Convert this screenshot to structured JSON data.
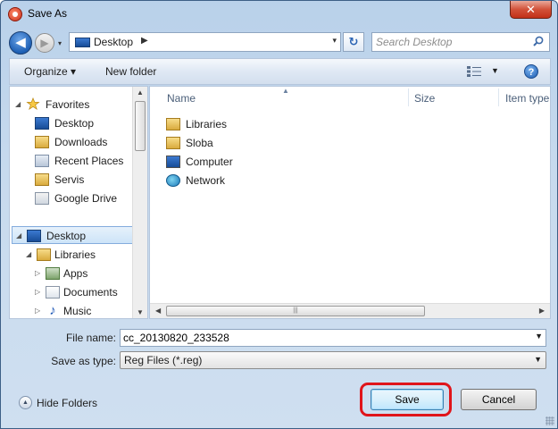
{
  "window": {
    "title": "Save As",
    "close_label": "✕"
  },
  "address": {
    "location": "Desktop",
    "search_placeholder": "Search Desktop"
  },
  "toolbar": {
    "organize_label": "Organize ▾",
    "new_folder_label": "New folder",
    "help_label": "?"
  },
  "sidebar": {
    "favorites_label": "Favorites",
    "favorites": [
      "Desktop",
      "Downloads",
      "Recent Places",
      "Servis",
      "Google Drive"
    ],
    "desktop_label": "Desktop",
    "libraries_label": "Libraries",
    "libraries": [
      "Apps",
      "Documents",
      "Music"
    ]
  },
  "columns": {
    "name": "Name",
    "size": "Size",
    "type": "Item type"
  },
  "files": [
    "Libraries",
    "Sloba",
    "Computer",
    "Network"
  ],
  "form": {
    "file_name_label": "File name:",
    "file_name_value": "cc_20130820_233528",
    "save_type_label": "Save as type:",
    "save_type_value": "Reg Files (*.reg)"
  },
  "footer": {
    "hide_folders_label": "Hide Folders",
    "save_label": "Save",
    "cancel_label": "Cancel"
  },
  "colors": {
    "highlight_ring": "#e0141a",
    "selection": "#cde4f8"
  }
}
